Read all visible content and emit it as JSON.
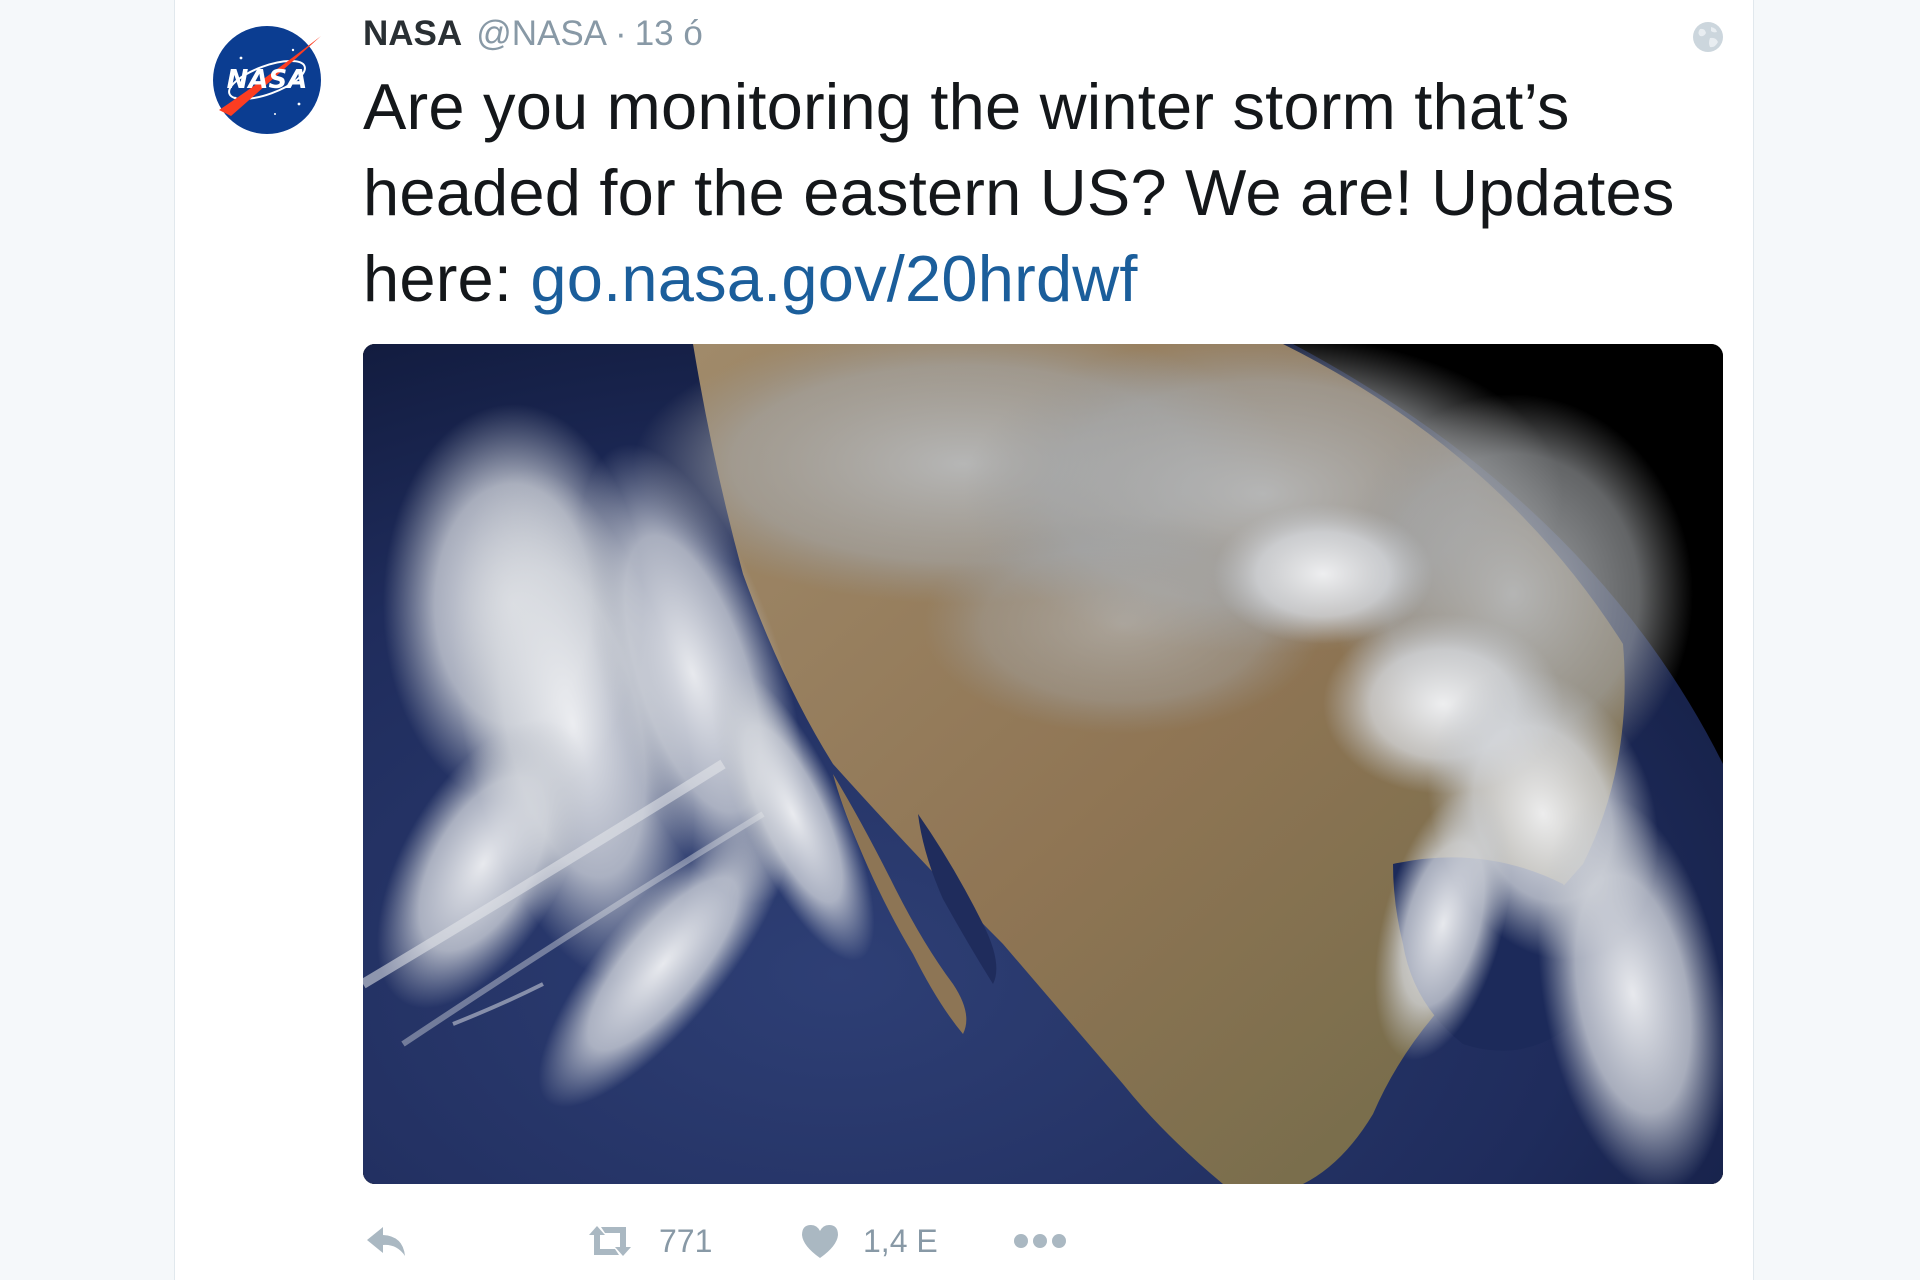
{
  "tweet": {
    "author_name": "NASA",
    "author_handle": "@NASA",
    "separator": "·",
    "timestamp": "13 ó",
    "text_before_link": "Are you monitoring the winter storm that’s headed for the eastern US? We are! Updates here: ",
    "link_text": "go.nasa.gov/20hrdwf",
    "avatar_logo_text": "NASA",
    "media_alt": "Satellite image of a winter storm over North America"
  },
  "actions": {
    "reply": {
      "icon": "reply-icon"
    },
    "retweet": {
      "icon": "retweet-icon",
      "count": "771"
    },
    "like": {
      "icon": "heart-icon",
      "count": "1,4 E"
    },
    "more": {
      "icon": "more-dots-icon"
    }
  },
  "colors": {
    "link": "#1b5e9b",
    "muted": "#8899a6",
    "nasa_blue": "#0b3d91",
    "nasa_red": "#fc3d21"
  }
}
